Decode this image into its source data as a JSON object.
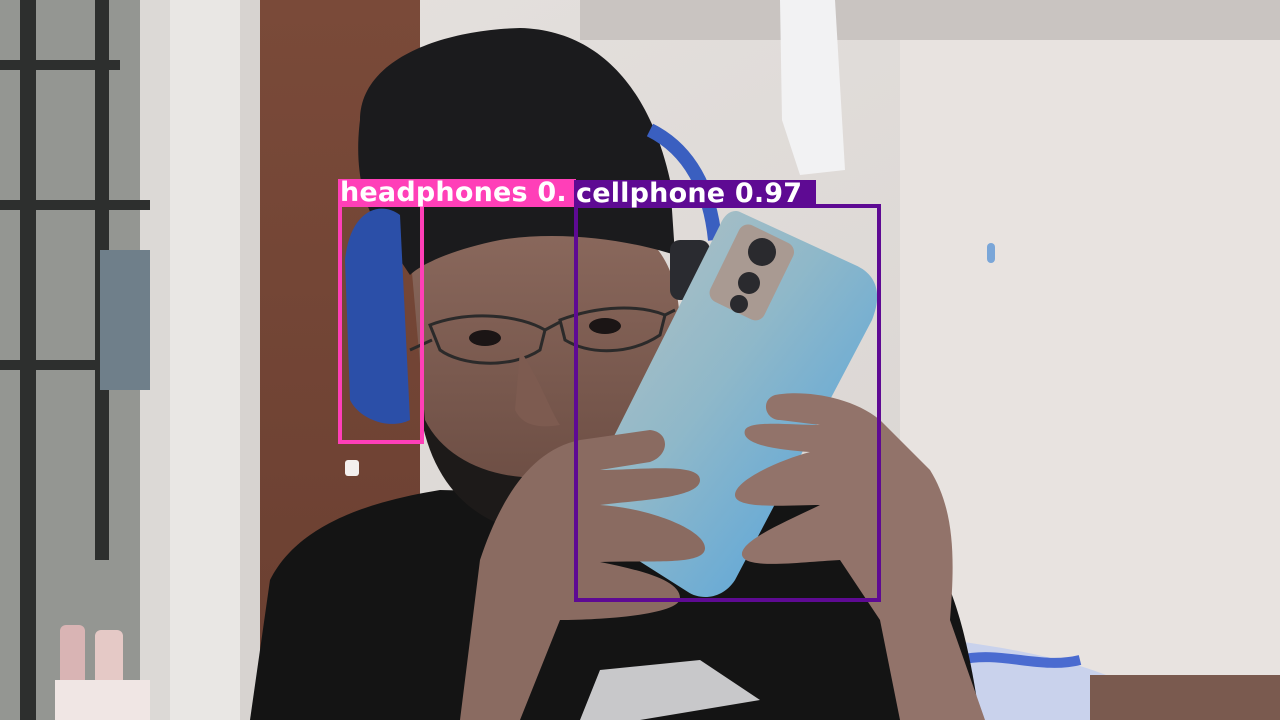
{
  "detections": [
    {
      "class_label": "headphones 0.",
      "color": "#ff3fb8"
    },
    {
      "class_label": "cellphone 0.97",
      "color": "#5e0a93"
    }
  ]
}
